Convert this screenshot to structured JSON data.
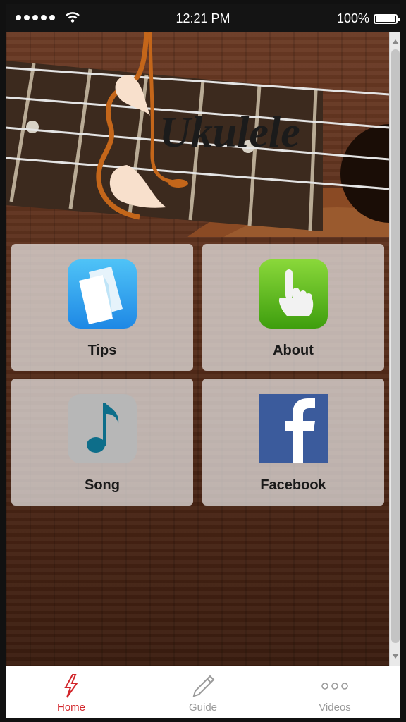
{
  "status_bar": {
    "time": "12:21 PM",
    "battery": "100%"
  },
  "header": {
    "logo_text": "Ukulele"
  },
  "tiles": [
    {
      "label": "Tips",
      "icon": "documents-icon"
    },
    {
      "label": "About",
      "icon": "pointing-hand-icon"
    },
    {
      "label": "Song",
      "icon": "music-note-icon"
    },
    {
      "label": "Facebook",
      "icon": "facebook-icon"
    }
  ],
  "tabbar": {
    "items": [
      {
        "label": "Home",
        "icon": "lightning-icon",
        "active": true
      },
      {
        "label": "Guide",
        "icon": "pencil-icon",
        "active": false
      },
      {
        "label": "Videos",
        "icon": "more-dots-icon",
        "active": false
      }
    ]
  },
  "colors": {
    "active_tab": "#d2262b",
    "inactive_tab": "#9a9a9a",
    "brand_orange": "#c4661a"
  }
}
